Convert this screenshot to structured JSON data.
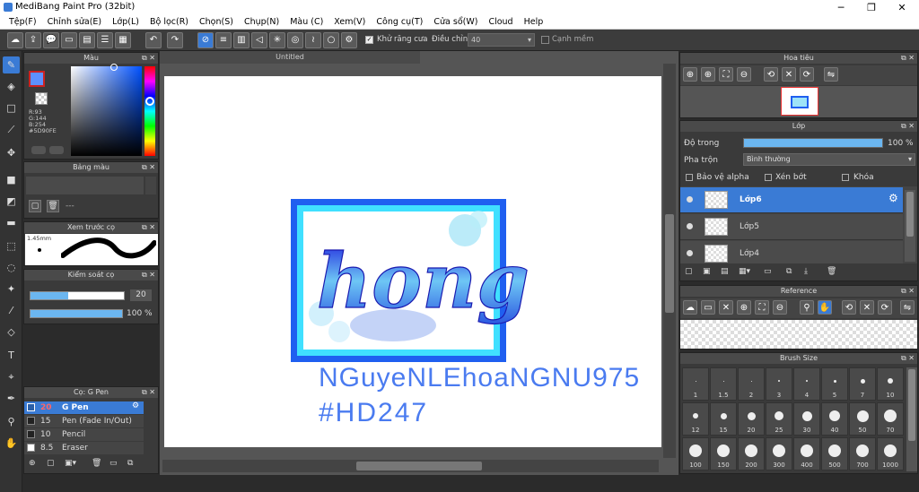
{
  "window": {
    "title": "MediBang Paint Pro (32bit)"
  },
  "menu": [
    "Tệp(F)",
    "Chỉnh sửa(E)",
    "Lớp(L)",
    "Bộ lọc(R)",
    "Chọn(S)",
    "Chụp(N)",
    "Màu (C)",
    "Xem(V)",
    "Công cụ(T)",
    "Cửa sổ(W)",
    "Cloud",
    "Help"
  ],
  "toolbar": {
    "antialias_label": "Khử răng cưa",
    "adjust_label": "Điều chỉnh",
    "adjust_value": "40",
    "edge_label": "Cạnh mềm"
  },
  "color_panel": {
    "title": "Màu",
    "r": "R:93",
    "g": "G:144",
    "b": "B:254",
    "hex": "#5D90FE",
    "color": "#5D90FE"
  },
  "palette_panel": {
    "title": "Bảng màu",
    "dash": "---"
  },
  "brush_preview": {
    "title": "Xem trước cọ",
    "size": "1.45mm"
  },
  "brush_control": {
    "title": "Kiểm soát cọ",
    "size_value": "20",
    "opacity_value": "100 %",
    "size_fraction": 0.4,
    "opacity_fraction": 1.0
  },
  "brush_panel": {
    "title": "Cọ: G Pen",
    "items": [
      {
        "size": "20",
        "name": "G Pen"
      },
      {
        "size": "15",
        "name": "Pen (Fade In/Out)"
      },
      {
        "size": "10",
        "name": "Pencil"
      },
      {
        "size": "8.5",
        "name": "Eraser"
      }
    ]
  },
  "canvas": {
    "tab": "Untitled",
    "art_word": "hong",
    "handwriting_line1": "NGuyeNLEhoaNGNU975",
    "handwriting_line2": "#HD247"
  },
  "navigator": {
    "title": "Hoa tiêu"
  },
  "layers": {
    "title": "Lớp",
    "opacity_label": "Độ trong",
    "opacity_value": "100 %",
    "opacity_fraction": 1.0,
    "blend_label": "Pha trộn",
    "blend_value": "Bình thường",
    "protect_alpha": "Bảo vệ alpha",
    "clipping": "Xén bớt",
    "lock": "Khóa",
    "items": [
      "Lớp6",
      "Lớp5",
      "Lớp4"
    ]
  },
  "reference": {
    "title": "Reference"
  },
  "brush_size": {
    "title": "Brush Size",
    "sizes": [
      "1",
      "1.5",
      "2",
      "3",
      "4",
      "5",
      "7",
      "10",
      "12",
      "15",
      "20",
      "25",
      "30",
      "40",
      "50",
      "70",
      "100",
      "150",
      "200",
      "300",
      "400",
      "500",
      "700",
      "1000"
    ]
  }
}
